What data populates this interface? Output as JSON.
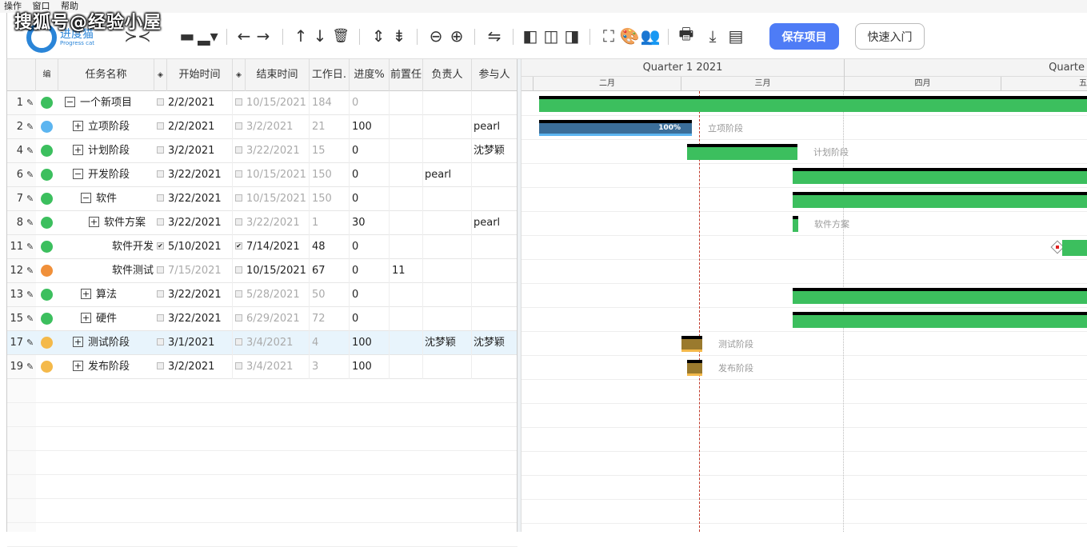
{
  "watermark": "搜狐号@经验小屋",
  "menu": [
    "操作",
    "窗口",
    "帮助"
  ],
  "logo": {
    "name": "进度猫",
    "sub": "Progress cat"
  },
  "buttons": {
    "save": "保存项目",
    "quick": "快速入门"
  },
  "columns": {
    "seq": "编",
    "name": "任务名称",
    "start": "开始时间",
    "end": "结束时间",
    "days": "工作日.",
    "progress": "进度%",
    "pred": "前置任",
    "owner": "负责人",
    "participants": "参与人"
  },
  "rows": [
    {
      "num": "1",
      "color": "#3cbf5e",
      "indent": 0,
      "expander": "−",
      "name": "一个新项目",
      "start": "2/2/2021",
      "start_checked": false,
      "start_dim": false,
      "end": "10/15/2021",
      "end_checked": false,
      "end_dim": true,
      "days": "184",
      "days_dim": true,
      "progress": "0",
      "progress_dim": true,
      "pred": "",
      "owner": "",
      "participants": ""
    },
    {
      "num": "2",
      "color": "#5cb5f0",
      "indent": 1,
      "expander": "+",
      "name": "立项阶段",
      "start": "2/2/2021",
      "start_checked": false,
      "start_dim": false,
      "end": "3/2/2021",
      "end_checked": false,
      "end_dim": true,
      "days": "21",
      "days_dim": true,
      "progress": "100",
      "progress_dim": false,
      "pred": "",
      "owner": "",
      "participants": "pearl"
    },
    {
      "num": "4",
      "color": "#3cbf5e",
      "indent": 1,
      "expander": "+",
      "name": "计划阶段",
      "start": "3/2/2021",
      "start_checked": false,
      "start_dim": false,
      "end": "3/22/2021",
      "end_checked": false,
      "end_dim": true,
      "days": "15",
      "days_dim": true,
      "progress": "0",
      "progress_dim": false,
      "pred": "",
      "owner": "",
      "participants": "沈梦颖"
    },
    {
      "num": "6",
      "color": "#3cbf5e",
      "indent": 1,
      "expander": "−",
      "name": "开发阶段",
      "start": "3/22/2021",
      "start_checked": false,
      "start_dim": false,
      "end": "10/15/2021",
      "end_checked": false,
      "end_dim": true,
      "days": "150",
      "days_dim": true,
      "progress": "0",
      "progress_dim": false,
      "pred": "",
      "owner": "pearl",
      "participants": ""
    },
    {
      "num": "7",
      "color": "#3cbf5e",
      "indent": 2,
      "expander": "−",
      "name": "软件",
      "start": "3/22/2021",
      "start_checked": false,
      "start_dim": false,
      "end": "10/15/2021",
      "end_checked": false,
      "end_dim": true,
      "days": "150",
      "days_dim": true,
      "progress": "0",
      "progress_dim": false,
      "pred": "",
      "owner": "",
      "participants": ""
    },
    {
      "num": "8",
      "color": "#3cbf5e",
      "indent": 3,
      "expander": "+",
      "name": "软件方案",
      "start": "3/22/2021",
      "start_checked": false,
      "start_dim": false,
      "end": "3/22/2021",
      "end_checked": false,
      "end_dim": true,
      "days": "1",
      "days_dim": true,
      "progress": "30",
      "progress_dim": false,
      "pred": "",
      "owner": "",
      "participants": "pearl"
    },
    {
      "num": "11",
      "color": "#3cbf5e",
      "indent": 4,
      "expander": "",
      "name": "软件开发",
      "start": "5/10/2021",
      "start_checked": true,
      "start_dim": false,
      "end": "7/14/2021",
      "end_checked": true,
      "end_dim": false,
      "days": "48",
      "days_dim": false,
      "progress": "0",
      "progress_dim": false,
      "pred": "",
      "owner": "",
      "participants": ""
    },
    {
      "num": "12",
      "color": "#f0903a",
      "indent": 4,
      "expander": "",
      "name": "软件测试",
      "start": "7/15/2021",
      "start_checked": false,
      "start_dim": true,
      "end": "10/15/2021",
      "end_checked": false,
      "end_dim": false,
      "days": "67",
      "days_dim": false,
      "progress": "0",
      "progress_dim": false,
      "pred": "11",
      "owner": "",
      "participants": ""
    },
    {
      "num": "13",
      "color": "#3cbf5e",
      "indent": 2,
      "expander": "+",
      "name": "算法",
      "start": "3/22/2021",
      "start_checked": false,
      "start_dim": false,
      "end": "5/28/2021",
      "end_checked": false,
      "end_dim": true,
      "days": "50",
      "days_dim": true,
      "progress": "0",
      "progress_dim": false,
      "pred": "",
      "owner": "",
      "participants": ""
    },
    {
      "num": "15",
      "color": "#3cbf5e",
      "indent": 2,
      "expander": "+",
      "name": "硬件",
      "start": "3/22/2021",
      "start_checked": false,
      "start_dim": false,
      "end": "6/29/2021",
      "end_checked": false,
      "end_dim": true,
      "days": "72",
      "days_dim": true,
      "progress": "0",
      "progress_dim": false,
      "pred": "",
      "owner": "",
      "participants": ""
    },
    {
      "num": "17",
      "color": "#f4b94a",
      "indent": 1,
      "expander": "+",
      "name": "测试阶段",
      "start": "3/1/2021",
      "start_checked": false,
      "start_dim": false,
      "end": "3/4/2021",
      "end_checked": false,
      "end_dim": true,
      "days": "4",
      "days_dim": true,
      "progress": "100",
      "progress_dim": false,
      "pred": "",
      "owner": "沈梦颖",
      "participants": "沈梦颖",
      "selected": true
    },
    {
      "num": "19",
      "color": "#f4b94a",
      "indent": 1,
      "expander": "+",
      "name": "发布阶段",
      "start": "3/2/2021",
      "start_checked": false,
      "start_dim": false,
      "end": "3/4/2021",
      "end_checked": false,
      "end_dim": true,
      "days": "3",
      "days_dim": true,
      "progress": "100",
      "progress_dim": false,
      "pred": "",
      "owner": "",
      "participants": ""
    }
  ],
  "gantt": {
    "quarters": [
      "Quarter 1 2021",
      "Quarte"
    ],
    "months": [
      "二月",
      "三月",
      "四月",
      "五"
    ],
    "bar_labels": {
      "lixiang": "立项阶段",
      "jihua": "计划阶段",
      "ruanjian_fangan": "软件方案",
      "ceshi": "测试阶段",
      "fabu": "发布阶段"
    },
    "progress_text": "100%"
  },
  "colors": {
    "accent": "#4e7cf6",
    "bar_green": "#3cbf5e",
    "bar_blue": "#3b6e99",
    "bar_gold": "#9a7a2e",
    "today_line": "#c0392b"
  }
}
